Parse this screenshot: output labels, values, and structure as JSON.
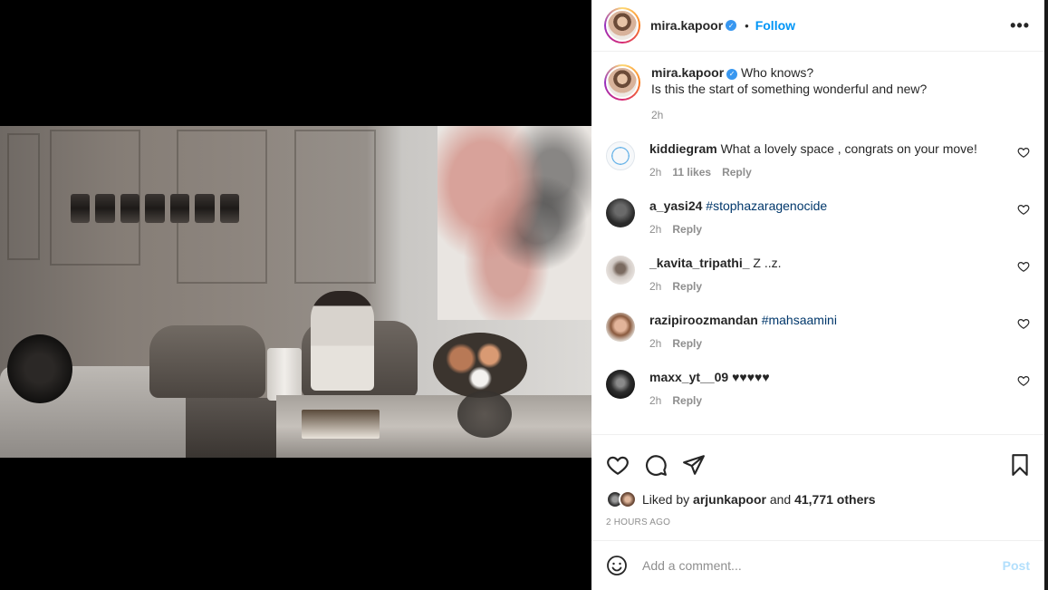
{
  "post": {
    "author": "mira.kapoor",
    "follow_label": "Follow",
    "more_label": "•••",
    "caption_line1": "Who knows?",
    "caption_line2": "Is this the start of something wonderful and new?",
    "caption_time": "2h"
  },
  "comments": [
    {
      "user": "kiddiegram",
      "text": "What a lovely space , congrats on your move!",
      "time": "2h",
      "likes": "11 likes",
      "reply": "Reply",
      "avatar_color": "#e9eef3"
    },
    {
      "user": "a_yasi24",
      "text": "#stophazaragenocide",
      "tag": true,
      "time": "2h",
      "reply": "Reply",
      "avatar_color": "#3a3a3a"
    },
    {
      "user": "_kavita_tripathi_",
      "text": "Z ..z.",
      "time": "2h",
      "reply": "Reply",
      "avatar_color": "#cfc7c2"
    },
    {
      "user": "razipiroozmandan",
      "text": "#mahsaamini",
      "tag": true,
      "time": "2h",
      "reply": "Reply",
      "avatar_color": "#b98a6b"
    },
    {
      "user": "maxx_yt__09",
      "text": "♥♥♥♥♥",
      "time": "2h",
      "reply": "Reply",
      "avatar_color": "#2d2d2d"
    }
  ],
  "likes": {
    "prefix": "Liked by",
    "user": "arjunkapoor",
    "connector": "and",
    "others": "41,771 others"
  },
  "timestamp": "2 HOURS AGO",
  "composer": {
    "placeholder": "Add a comment...",
    "post_label": "Post"
  },
  "colors": {
    "link": "#0095f6",
    "tag": "#00376b",
    "post_disabled": "#b2dffc"
  },
  "icons": [
    "heart-icon",
    "comment-icon",
    "share-icon",
    "bookmark-icon",
    "emoji-icon",
    "more-icon",
    "verified-badge-icon"
  ]
}
